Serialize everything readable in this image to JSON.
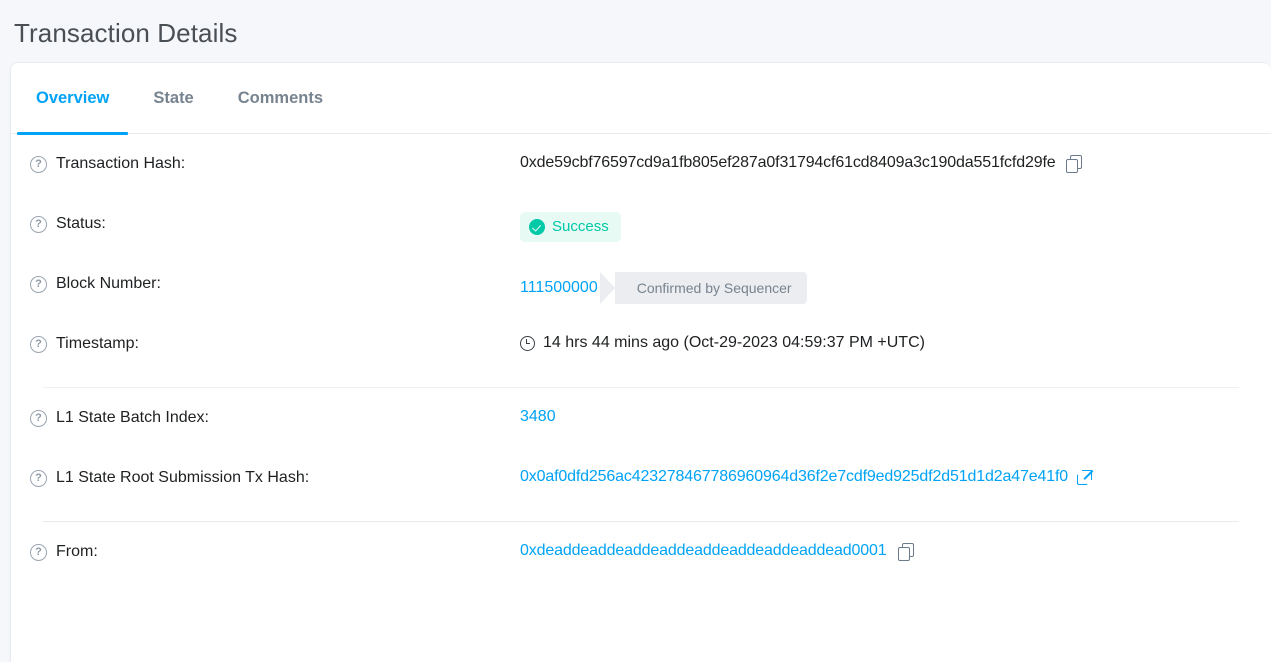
{
  "page": {
    "title": "Transaction Details"
  },
  "tabs": [
    {
      "label": "Overview",
      "active": true
    },
    {
      "label": "State",
      "active": false
    },
    {
      "label": "Comments",
      "active": false
    }
  ],
  "icons": {
    "help": "?",
    "copy": "copy-icon",
    "external_link": "external-link-icon",
    "clock": "clock-icon",
    "check": "check-circle-icon"
  },
  "colors": {
    "accent_blue": "#00a3f5",
    "success_green": "#00c9a7",
    "success_bg": "#e7faf4",
    "chip_bg": "#ecedf0",
    "page_bg": "#f5f7fa",
    "text_dark": "#1e2022",
    "text_muted": "#77838f"
  },
  "rows": {
    "transaction_hash": {
      "label": "Transaction Hash:",
      "value": "0xde59cbf76597cd9a1fb805ef287a0f31794cf61cd8409a3c190da551fcfd29fe"
    },
    "status": {
      "label": "Status:",
      "value": "Success"
    },
    "block_number": {
      "label": "Block Number:",
      "value": "111500000",
      "chip": "Confirmed by Sequencer"
    },
    "timestamp": {
      "label": "Timestamp:",
      "value": "14 hrs 44 mins ago (Oct-29-2023 04:59:37 PM +UTC)"
    },
    "l1_state_batch_index": {
      "label": "L1 State Batch Index:",
      "value": "3480"
    },
    "l1_state_root_submission_tx_hash": {
      "label": "L1 State Root Submission Tx Hash:",
      "value": "0x0af0dfd256ac423278467786960964d36f2e7cdf9ed925df2d51d1d2a47e41f0"
    },
    "from": {
      "label": "From:",
      "value": "0xdeaddeaddeaddeaddeaddeaddeaddeaddead0001"
    }
  }
}
